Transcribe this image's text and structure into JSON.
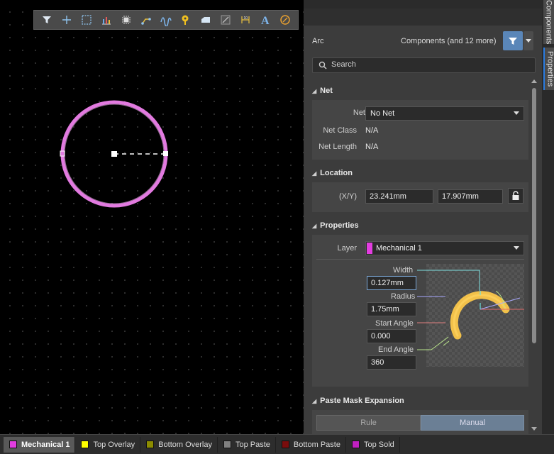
{
  "toolbar": {
    "icons": [
      "filter-icon",
      "crosshair-icon",
      "select-rect-icon",
      "chart-icon",
      "component-icon",
      "route-icon",
      "interactive-route-icon",
      "pad-icon",
      "fill-icon",
      "line-region-icon",
      "dimension-icon",
      "text-icon",
      "arc-tool-icon"
    ]
  },
  "arc": {
    "color": "#e27ae0",
    "handle_color": "#ffffff"
  },
  "panel": {
    "object_type": "Arc",
    "filter_summary": "Components (and 12 more)",
    "search_placeholder": "Search",
    "tabs": {
      "components": "Components",
      "properties": "Properties"
    },
    "net_section": {
      "title": "Net",
      "net_label": "Net",
      "net_value": "No Net",
      "net_class_label": "Net Class",
      "net_class_value": "N/A",
      "net_length_label": "Net Length",
      "net_length_value": "N/A"
    },
    "location_section": {
      "title": "Location",
      "xy_label": "(X/Y)",
      "x_value": "23.241mm",
      "y_value": "17.907mm"
    },
    "properties_section": {
      "title": "Properties",
      "layer_label": "Layer",
      "layer_value": "Mechanical 1",
      "layer_color": "#e33de0",
      "width_label": "Width",
      "width_value": "0.127mm",
      "radius_label": "Radius",
      "radius_value": "1.75mm",
      "start_angle_label": "Start Angle",
      "start_angle_value": "0.000",
      "end_angle_label": "End Angle",
      "end_angle_value": "360"
    },
    "paste_mask_section": {
      "title": "Paste Mask Expansion",
      "rule_label": "Rule",
      "manual_label": "Manual"
    }
  },
  "layer_tabs": [
    {
      "label": "Mechanical 1",
      "color": "#e33de0",
      "active": true
    },
    {
      "label": "Top Overlay",
      "color": "#ffff00",
      "active": false
    },
    {
      "label": "Bottom Overlay",
      "color": "#8c8c00",
      "active": false
    },
    {
      "label": "Top Paste",
      "color": "#808080",
      "active": false
    },
    {
      "label": "Bottom Paste",
      "color": "#7a0d0d",
      "active": false
    },
    {
      "label": "Top Sold",
      "color": "#c020c0",
      "active": false
    }
  ]
}
